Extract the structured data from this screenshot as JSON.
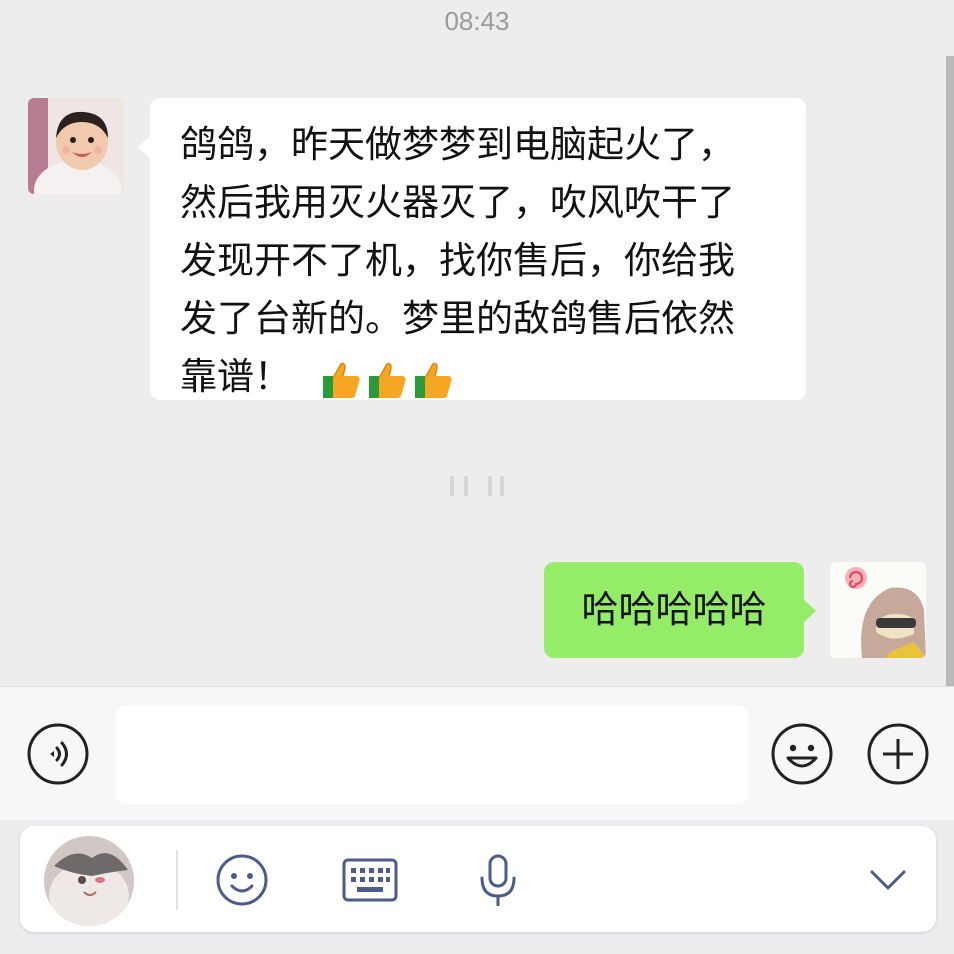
{
  "status": {
    "time": "08:43"
  },
  "messages": [
    {
      "sender": "friend",
      "lines": [
        "鸽鸽，昨天做梦梦到电脑起火了，",
        "然后我用灭火器灭了，吹风吹干了",
        "发现开不了机，找你售后，你给我",
        "发了台新的。梦里的敌鸽售后依然",
        "靠谱！"
      ],
      "emoji": [
        "thumbs-up",
        "thumbs-up",
        "thumbs-up"
      ]
    },
    {
      "sender": "me",
      "text": "哈哈哈哈哈"
    }
  ],
  "input": {
    "value": "",
    "placeholder": ""
  },
  "icons": {
    "voice": "voice-icon",
    "emoji": "smiley-icon",
    "plus": "plus-icon",
    "ime_emoji": "smiley-icon",
    "ime_keyboard": "keyboard-icon",
    "ime_mic": "microphone-icon",
    "ime_collapse": "chevron-down-icon"
  },
  "colors": {
    "background": "#ededed",
    "my_bubble": "#95ec69",
    "friend_bubble": "#ffffff",
    "ime_icon": "#4a5b8c"
  }
}
